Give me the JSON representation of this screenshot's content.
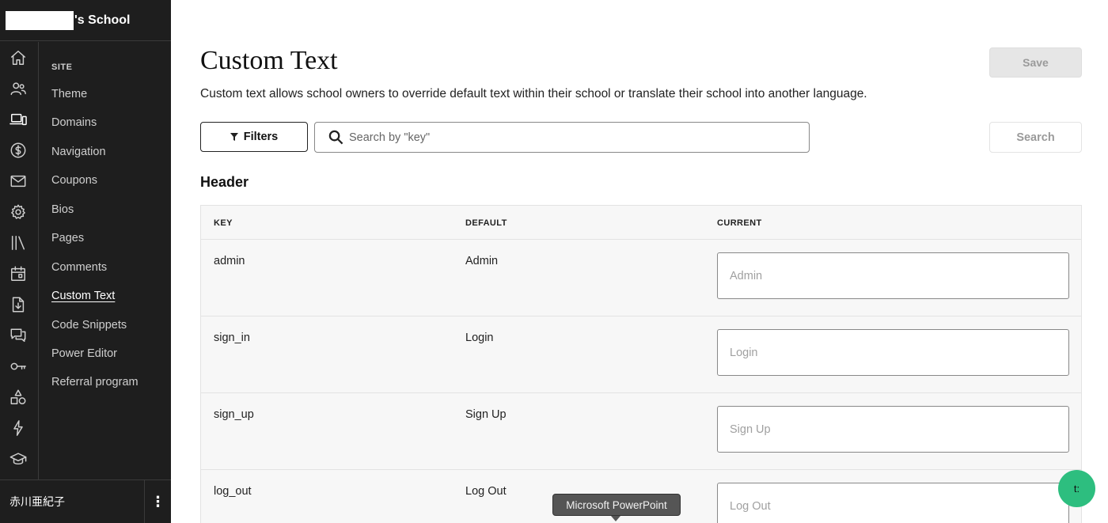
{
  "brand": {
    "name": "'s School"
  },
  "sidebar": {
    "icons": [
      {
        "name": "home-icon"
      },
      {
        "name": "users-icon"
      },
      {
        "name": "site-devices-icon"
      },
      {
        "name": "dollar-icon"
      },
      {
        "name": "mail-icon"
      },
      {
        "name": "gear-icon"
      },
      {
        "name": "library-icon"
      },
      {
        "name": "calendar-icon"
      },
      {
        "name": "download-file-icon"
      },
      {
        "name": "chat-icon"
      },
      {
        "name": "key-icon"
      },
      {
        "name": "shapes-icon"
      },
      {
        "name": "lightning-icon"
      },
      {
        "name": "graduation-cap-icon"
      }
    ],
    "section_label": "SITE",
    "items": [
      {
        "label": "Theme"
      },
      {
        "label": "Domains"
      },
      {
        "label": "Navigation"
      },
      {
        "label": "Coupons"
      },
      {
        "label": "Bios"
      },
      {
        "label": "Pages"
      },
      {
        "label": "Comments"
      },
      {
        "label": "Custom Text",
        "active": true
      },
      {
        "label": "Code Snippets"
      },
      {
        "label": "Power Editor"
      },
      {
        "label": "Referral program"
      }
    ],
    "user": {
      "name": "赤川亜紀子",
      "menu_glyph": "⋮"
    }
  },
  "main": {
    "title": "Custom Text",
    "description": "Custom text allows school owners to override default text within their school or translate their school into another language.",
    "save_label": "Save",
    "filters_label": "Filters",
    "search_placeholder": "Search by \"key\"",
    "search_label": "Search",
    "section_title": "Header",
    "table": {
      "columns": [
        "KEY",
        "DEFAULT",
        "CURRENT"
      ],
      "rows": [
        {
          "key": "admin",
          "default": "Admin",
          "placeholder": "Admin"
        },
        {
          "key": "sign_in",
          "default": "Login",
          "placeholder": "Login"
        },
        {
          "key": "sign_up",
          "default": "Sign Up",
          "placeholder": "Sign Up"
        },
        {
          "key": "log_out",
          "default": "Log Out",
          "placeholder": "Log Out"
        }
      ]
    }
  },
  "tooltip": {
    "text": "Microsoft PowerPoint"
  },
  "chat_bubble": {
    "label": "t:"
  },
  "colors": {
    "sidebar_bg": "#1e1e1e",
    "accent_green": "#2dbe7f",
    "disabled_text": "#9a9a9a"
  }
}
